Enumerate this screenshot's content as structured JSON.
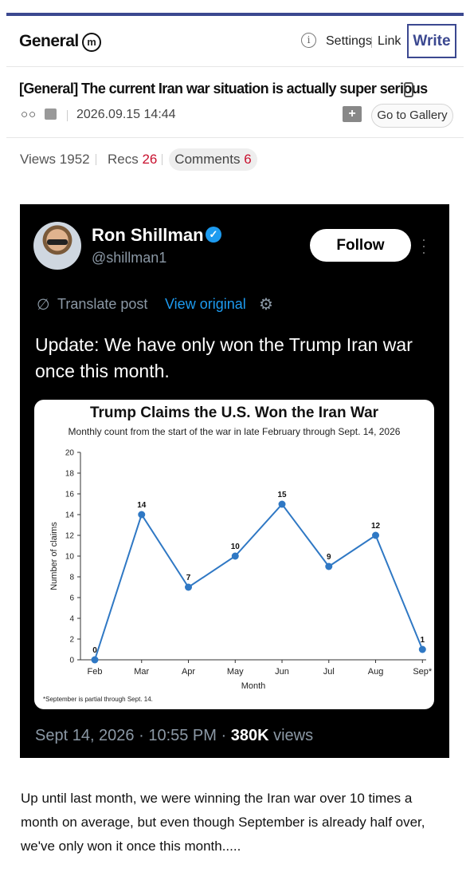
{
  "header": {
    "board": "General",
    "board_badge": "m",
    "info": "i",
    "settings": "Settings",
    "link": "Link",
    "write": "Write"
  },
  "post": {
    "title": "[General] The current Iran war situation is actually super serious",
    "author": "○○",
    "date": "2026.09.15 14:44",
    "gallery_button": "Go to Gallery",
    "views_label": "Views",
    "views": "1952",
    "recs_label": "Recs",
    "recs": "26",
    "comments_label": "Comments",
    "comments": "6",
    "body": "Up until last month, we were winning the Iran war over 10 times a month on average, but even though September is already half over, we've only won it once this month....."
  },
  "tweet": {
    "name": "Ron Shillman",
    "handle": "@shillman1",
    "follow": "Follow",
    "translate": "Translate post",
    "view_original": "View original",
    "text": "Update: We have only won the Trump Iran war once this month.",
    "date": "Sept 14, 2026 · 10:55 PM · ",
    "views_count": "380K",
    "views_label": " views"
  },
  "colors": {
    "accent": "#3b4890",
    "red": "#c8102e",
    "line": "#2f78c4",
    "twitter_blue": "#1d9bf0"
  },
  "chart_data": {
    "type": "line",
    "title": "Trump Claims the U.S. Won the Iran War",
    "subtitle": "Monthly count from the start of the war in late February through Sept. 14, 2026",
    "xlabel": "Month",
    "ylabel": "Number of claims",
    "categories": [
      "Feb",
      "Mar",
      "Apr",
      "May",
      "Jun",
      "Jul",
      "Aug",
      "Sep*"
    ],
    "values": [
      0,
      14,
      7,
      10,
      15,
      9,
      12,
      1
    ],
    "ylim": [
      0,
      20
    ],
    "yticks": [
      0,
      2,
      4,
      6,
      8,
      10,
      12,
      14,
      16,
      18,
      20
    ],
    "footnote": "*September is partial through Sept. 14.",
    "grid": false
  }
}
